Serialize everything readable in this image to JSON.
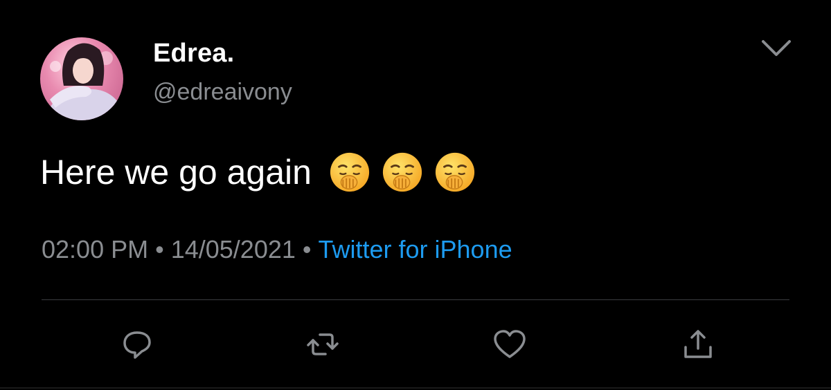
{
  "user": {
    "display_name": "Edrea.",
    "handle": "@edreaivony"
  },
  "tweet": {
    "text": "Here we go again",
    "emojis": [
      "yawning-face",
      "yawning-face",
      "yawning-face"
    ]
  },
  "meta": {
    "time": "02:00 PM",
    "separator": "•",
    "date": "14/05/2021",
    "source": "Twitter for iPhone"
  },
  "actions": {
    "icons": [
      "reply-icon",
      "retweet-icon",
      "like-icon",
      "share-icon"
    ]
  },
  "colors": {
    "background": "#000000",
    "text": "#ffffff",
    "secondary": "#8a8d91",
    "link": "#1d9bf0",
    "divider": "#3a3d40"
  }
}
